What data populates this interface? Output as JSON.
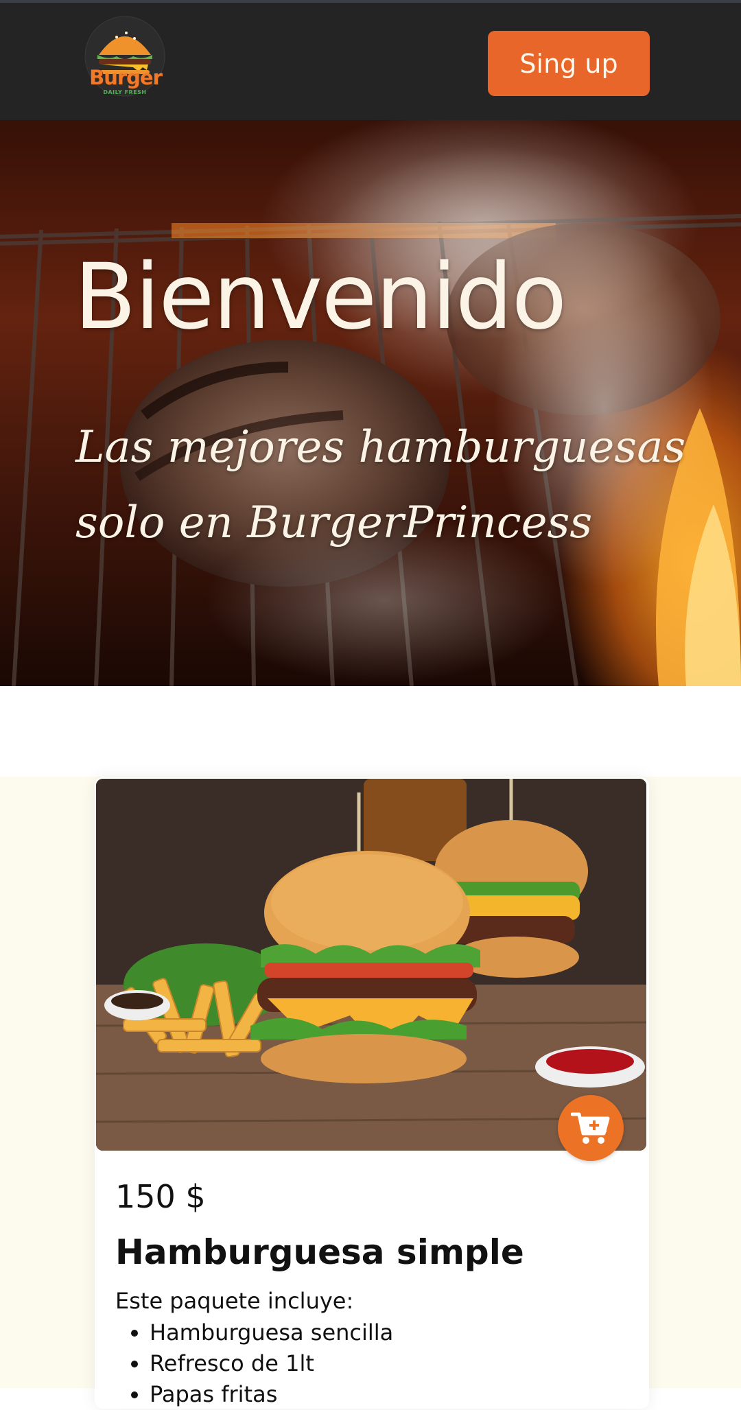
{
  "header": {
    "logo_text": "Burger",
    "logo_subtext": "DAILY FRESH",
    "signup_label": "Sing up"
  },
  "hero": {
    "title": "Bienvenido",
    "subtitle": "Las mejores hamburguesas solo en BurgerPrincess"
  },
  "product": {
    "price": "150 $",
    "name": "Hamburguesa simple",
    "includes_label": "Este paquete incluye:",
    "items": [
      "Hamburguesa sencilla",
      "Refresco de 1lt",
      "Papas fritas"
    ]
  },
  "colors": {
    "header_bg": "#242424",
    "accent": "#e8662a",
    "cream": "#fdfbee"
  },
  "icons": {
    "cart": "cart-plus-icon",
    "logo": "burger-logo-icon"
  }
}
